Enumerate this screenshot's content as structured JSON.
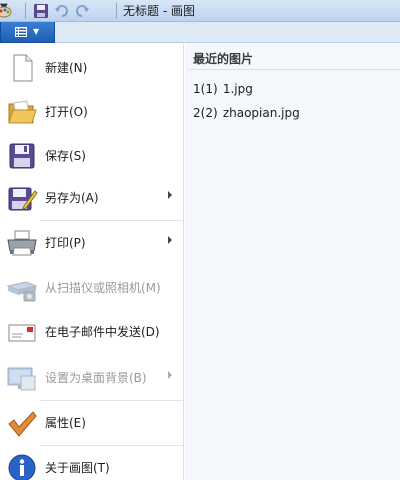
{
  "window": {
    "title": "无标题 - 画图",
    "quick_access": [
      "paint-icon",
      "save-icon",
      "undo-icon",
      "redo-icon",
      "customize-arrow"
    ]
  },
  "file_menu": {
    "tab_icon": "file-menu-icon",
    "items": [
      {
        "label": "新建(N)",
        "icon": "new-document-icon",
        "enabled": true,
        "submenu": false
      },
      {
        "label": "打开(O)",
        "icon": "open-folder-icon",
        "enabled": true,
        "submenu": false
      },
      {
        "label": "保存(S)",
        "icon": "floppy-save-icon",
        "enabled": true,
        "submenu": false
      },
      {
        "label": "另存为(A)",
        "icon": "save-as-icon",
        "enabled": true,
        "submenu": true
      },
      {
        "label": "打印(P)",
        "icon": "printer-icon",
        "enabled": true,
        "submenu": true
      },
      {
        "label": "从扫描仪或照相机(M)",
        "icon": "scanner-icon",
        "enabled": false,
        "submenu": false
      },
      {
        "label": "在电子邮件中发送(D)",
        "icon": "email-icon",
        "enabled": true,
        "submenu": false
      },
      {
        "label": "设置为桌面背景(B)",
        "icon": "desktop-background-icon",
        "enabled": false,
        "submenu": true
      },
      {
        "label": "属性(E)",
        "icon": "checkmark-icon",
        "enabled": true,
        "submenu": false
      },
      {
        "label": "关于画图(T)",
        "icon": "info-icon",
        "enabled": true,
        "submenu": false
      }
    ]
  },
  "recent": {
    "title": "最近的图片",
    "items": [
      {
        "num": "1(1)",
        "name": "1.jpg"
      },
      {
        "num": "2(2)",
        "name": "zhaopian.jpg"
      }
    ]
  }
}
